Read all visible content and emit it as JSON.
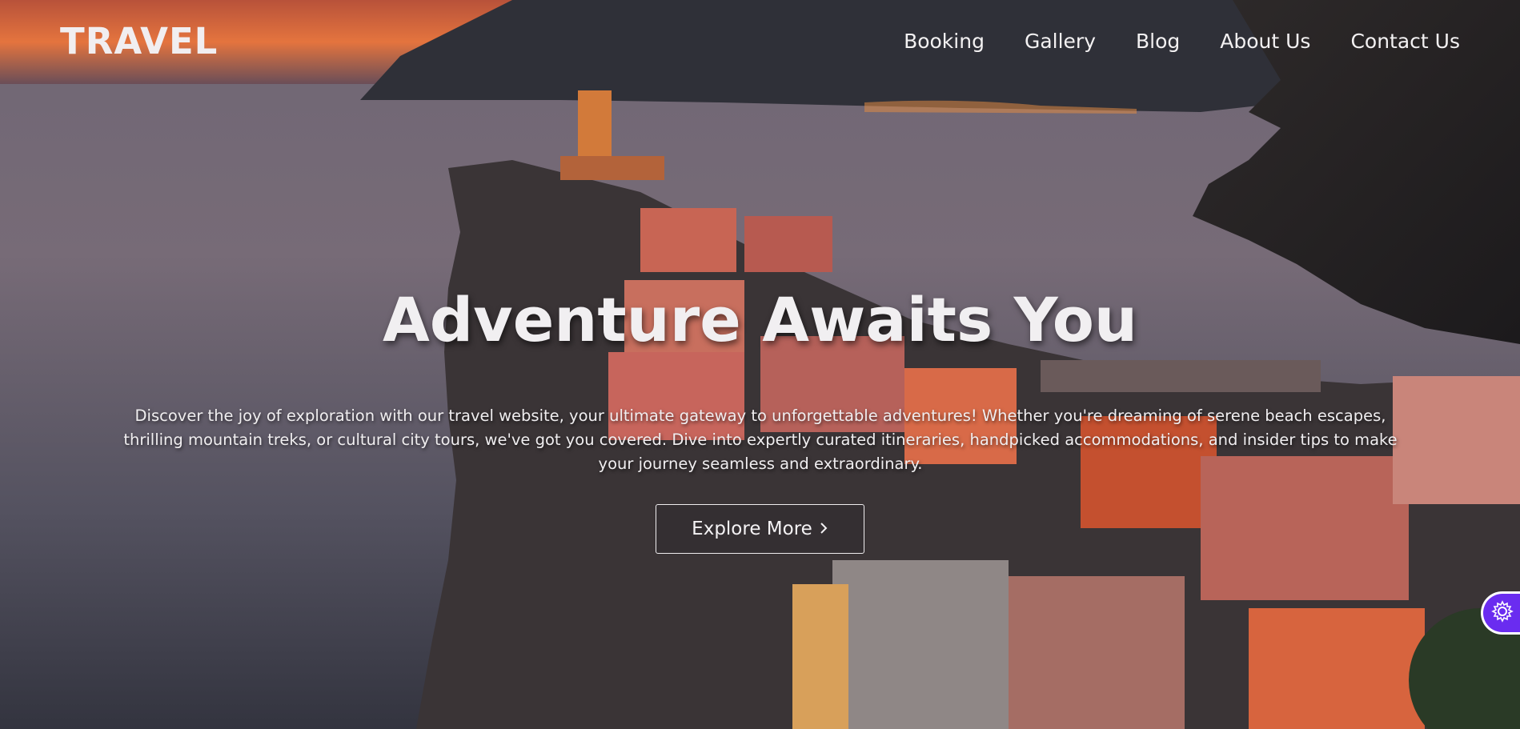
{
  "brand": {
    "logo": "TRAVEL"
  },
  "nav": {
    "items": [
      {
        "label": "Booking"
      },
      {
        "label": "Gallery"
      },
      {
        "label": "Blog"
      },
      {
        "label": "About Us"
      },
      {
        "label": "Contact Us"
      }
    ]
  },
  "hero": {
    "headline": "Adventure Awaits You",
    "description": "Discover the joy of exploration with our travel website, your ultimate gateway to unforgettable adventures! Whether you're dreaming of serene beach escapes, thrilling mountain treks, or cultural city tours, we've got you covered. Dive into expertly curated itineraries, handpicked accommodations, and insider tips to make your journey seamless and extraordinary.",
    "cta_label": "Explore More",
    "cta_icon": "chevron-right-icon"
  },
  "widgets": {
    "settings_icon": "gear-icon"
  },
  "colors": {
    "accent": "#6a2cf0",
    "text": "#f1eff1",
    "sky": "#c95a3a"
  }
}
